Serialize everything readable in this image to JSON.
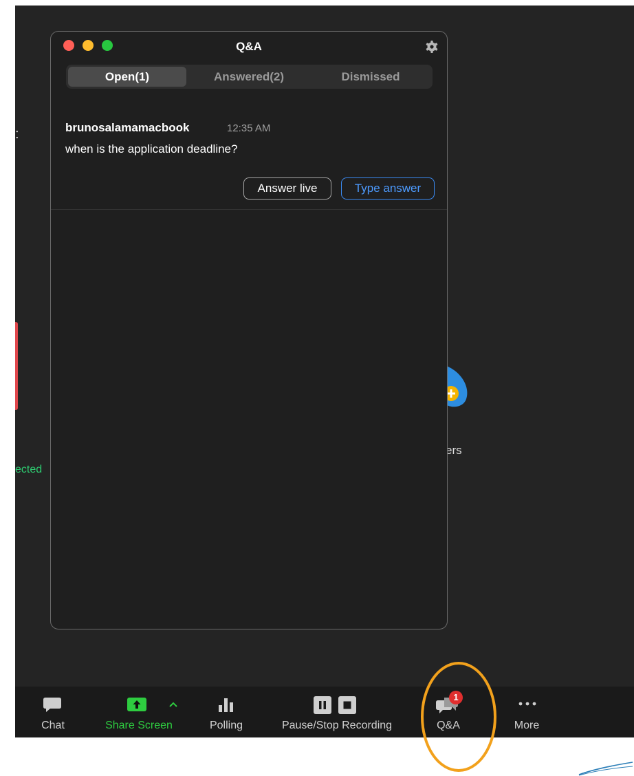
{
  "panel": {
    "title": "Q&A",
    "tabs": [
      {
        "label": "Open(1)",
        "active": true
      },
      {
        "label": "Answered(2)",
        "active": false
      },
      {
        "label": "Dismissed",
        "active": false
      }
    ],
    "question": {
      "author": "brunosalamamacbook",
      "time": "12:35 AM",
      "text": "when is the application deadline?",
      "answer_live_label": "Answer live",
      "type_answer_label": "Type answer"
    }
  },
  "background": {
    "colon": ":",
    "connected_fragment": "ected",
    "participants_fragment": "ers"
  },
  "toolbar": {
    "chat": "Chat",
    "share_screen": "Share Screen",
    "polling": "Polling",
    "recording": "Pause/Stop Recording",
    "qa": "Q&A",
    "qa_badge": "1",
    "more": "More"
  },
  "colors": {
    "accent_blue": "#3b8cf5",
    "share_green": "#2ecc40",
    "badge_red": "#e02e2e",
    "highlight_orange": "#f2a11c",
    "close_dot": "#ff5f57",
    "minimize_dot": "#febc2e",
    "zoom_dot": "#28c840"
  },
  "icons": [
    "close-dot",
    "minimize-dot",
    "zoom-dot",
    "gear-icon",
    "chat-icon",
    "share-screen-icon",
    "chevron-up-icon",
    "polling-icon",
    "pause-icon",
    "stop-icon",
    "qa-icon",
    "more-icon"
  ]
}
